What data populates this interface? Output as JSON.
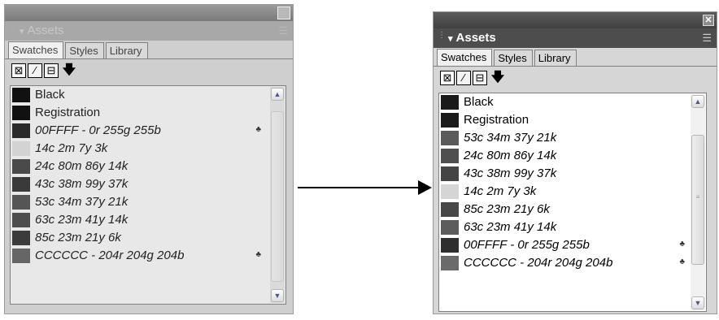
{
  "left_panel": {
    "header_title": "Assets",
    "tabs": [
      "Swatches",
      "Styles",
      "Library"
    ],
    "swatches": [
      {
        "name": "Black",
        "italic": false,
        "color": "#111111",
        "spot": false
      },
      {
        "name": "Registration",
        "italic": false,
        "color": "#111111",
        "spot": false
      },
      {
        "name": "00FFFF - 0r 255g 255b",
        "italic": true,
        "color": "#2a2a2a",
        "spot": true
      },
      {
        "name": "14c 2m 7y 3k",
        "italic": true,
        "color": "#d3d3d3",
        "spot": false
      },
      {
        "name": "24c 80m 86y 14k",
        "italic": true,
        "color": "#4a4a4a",
        "spot": false
      },
      {
        "name": "43c 38m 99y 37k",
        "italic": true,
        "color": "#3a3a3a",
        "spot": false
      },
      {
        "name": "53c 34m 37y 21k",
        "italic": true,
        "color": "#555555",
        "spot": false
      },
      {
        "name": "63c 23m 41y 14k",
        "italic": true,
        "color": "#4d4d4d",
        "spot": false
      },
      {
        "name": "85c 23m 21y 6k",
        "italic": true,
        "color": "#3c3c3c",
        "spot": false
      },
      {
        "name": "CCCCCC - 204r 204g 204b",
        "italic": true,
        "color": "#666666",
        "spot": true
      }
    ]
  },
  "right_panel": {
    "header_title": "Assets",
    "tabs": [
      "Swatches",
      "Styles",
      "Library"
    ],
    "swatches": [
      {
        "name": "Black",
        "italic": false,
        "color": "#1a1a1a",
        "spot": false
      },
      {
        "name": "Registration",
        "italic": false,
        "color": "#1a1a1a",
        "spot": false
      },
      {
        "name": "53c 34m 37y 21k",
        "italic": true,
        "color": "#5a5a5a",
        "spot": false
      },
      {
        "name": "24c 80m 86y 14k",
        "italic": true,
        "color": "#4f4f4f",
        "spot": false
      },
      {
        "name": "43c 38m 99y 37k",
        "italic": true,
        "color": "#444444",
        "spot": false
      },
      {
        "name": "14c 2m 7y 3k",
        "italic": true,
        "color": "#d5d5d5",
        "spot": false
      },
      {
        "name": "85c 23m 21y 6k",
        "italic": true,
        "color": "#484848",
        "spot": false
      },
      {
        "name": "63c 23m 41y 14k",
        "italic": true,
        "color": "#5c5c5c",
        "spot": false
      },
      {
        "name": "00FFFF - 0r 255g 255b",
        "italic": true,
        "color": "#2e2e2e",
        "spot": true
      },
      {
        "name": "CCCCCC - 204r 204g 204b",
        "italic": true,
        "color": "#6a6a6a",
        "spot": true
      }
    ]
  },
  "icons": {
    "close": "close-icon",
    "options": "panel-options-icon",
    "grip": "gripper-icon",
    "spot_color": "spot-color-icon",
    "fill": "fill-swatch-icon",
    "stroke": "stroke-swatch-icon",
    "text": "text-swatch-icon",
    "apply": "apply-arrow-icon"
  },
  "glyphs": {
    "close": "✕",
    "options": "☰",
    "caret": "▾",
    "grip": "⋮",
    "fill": "⊠",
    "stroke": "∕",
    "text": "⊟",
    "apply": "🡇",
    "spot": "♣",
    "up": "▲",
    "down": "▼"
  }
}
